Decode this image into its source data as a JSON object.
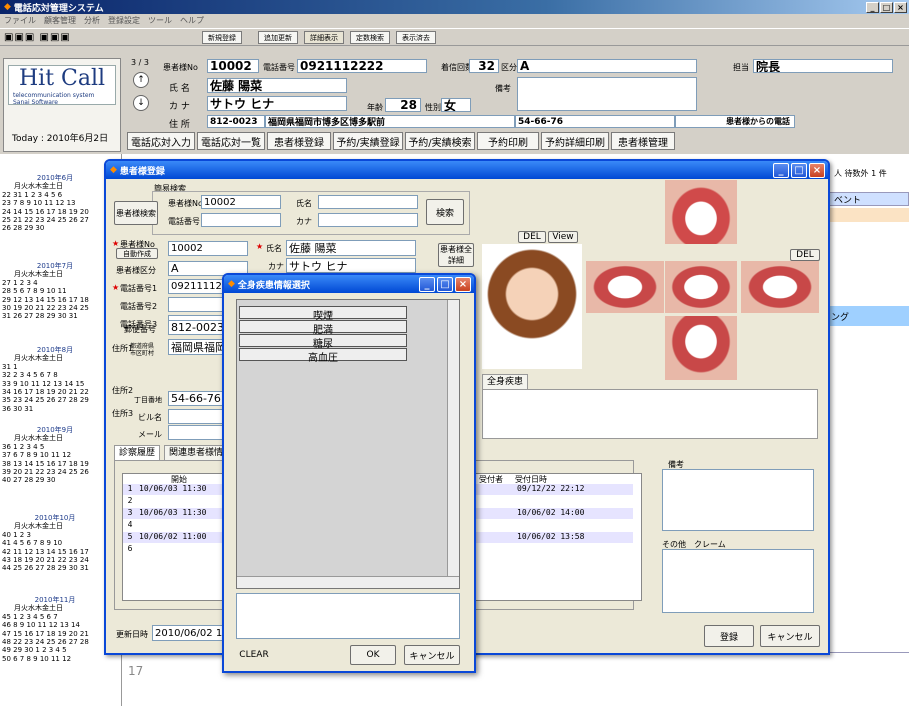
{
  "main": {
    "title": "電話応対管理システム",
    "menu": [
      "ファイル",
      "顧客管理",
      "分析",
      "登録設定",
      "ツール",
      "ヘルプ"
    ]
  },
  "toolbar": {
    "new": "新規登録",
    "add": "追加更新",
    "detail": "詳細表示",
    "reload": "定数検索",
    "display": "表示済去"
  },
  "logo": {
    "title": "Hit Call",
    "sub1": "telecommunication system",
    "sub2": "Sanai Software",
    "today": "Today : 2010年6月2日"
  },
  "patient": {
    "page": "3 / 3",
    "no_label": "患者様No",
    "no": "10002",
    "tel_label": "電話番号",
    "tel": "0921112222",
    "visits_label": "着信回数",
    "visits": "32",
    "kubun_label": "区分",
    "kubun": "A",
    "tanto_label": "担当",
    "tanto": "院長",
    "name_label": "氏 名",
    "name": "佐藤 陽菜",
    "biko_label": "備考",
    "kana_label": "カ ナ",
    "kana": "サトウ ヒナ",
    "age_label": "年齢",
    "age": "28",
    "sex_label": "性別",
    "sex": "女",
    "addr_label": "住 所",
    "zip": "812-0023",
    "addr": "福岡県福岡市博多区博多駅前",
    "chome": "54-66-76",
    "from": "患者様からの電話"
  },
  "nav": [
    "電話応対入力",
    "電話応対一覧",
    "患者様登録",
    "予約/実績登録",
    "予約/実績検索",
    "予約印刷",
    "予約詳細印刷",
    "患者様管理"
  ],
  "calendar": [
    {
      "title": "2010年6月",
      "dow": "月火水木金土日",
      "rows": [
        "22 31 1 2 3 4 5 6",
        "23 7 8 9 10 11 12 13",
        "24 14 15 16 17 18 19 20",
        "25 21 22 23 24 25 26 27",
        "26 28 29 30"
      ]
    },
    {
      "title": "2010年7月",
      "dow": "月火水木金土日",
      "rows": [
        "27  1 2 3 4",
        "28 5 6 7 8 9 10 11",
        "29 12 13 14 15 16 17 18",
        "30 19 20 21 22 23 24 25",
        "31 26 27 28 29 30 31"
      ]
    },
    {
      "title": "2010年8月",
      "dow": "月火水木金土日",
      "rows": [
        "31  1",
        "32 2 3 4 5 6 7 8",
        "33 9 10 11 12 13 14 15",
        "34 16 17 18 19 20 21 22",
        "35 23 24 25 26 27 28 29",
        "36 30 31"
      ]
    },
    {
      "title": "2010年9月",
      "dow": "月火水木金土日",
      "rows": [
        "36  1 2 3 4 5",
        "37 6 7 8 9 10 11 12",
        "38 13 14 15 16 17 18 19",
        "39 20 21 22 23 24 25 26",
        "40 27 28 29 30"
      ]
    },
    {
      "title": "2010年10月",
      "dow": "月火水木金土日",
      "rows": [
        "40  1 2 3",
        "41 4 5 6 7 8 9 10",
        "42 11 12 13 14 15 16 17",
        "43 18 19 20 21 22 23 24",
        "44 25 26 27 28 29 30 31"
      ]
    },
    {
      "title": "2010年11月",
      "dow": "月火水木金土日",
      "rows": [
        "45 1 2 3 4 5 6 7",
        "46 8 9 10 11 12 13 14",
        "47 15 16 17 18 19 20 21",
        "48 22 23 24 25 26 27 28",
        "49 29 30 1 2 3 4 5",
        "50 6 7 8 9 10 11 12"
      ]
    }
  ],
  "right": {
    "status": "人 待数外 1 件",
    "event": "ベント",
    "ng": "ング",
    "time": "17"
  },
  "reg": {
    "title": "患者様登録",
    "search_group": "簡易検索",
    "search_btn": "患者様検索",
    "s_no_label": "患者様No",
    "s_no": "10002",
    "s_tel_label": "電話番号",
    "s_name_label": "氏名",
    "s_kana_label": "カナ",
    "kensaku": "検索",
    "auto_label": "患者様No",
    "auto_btn": "自動作成",
    "no": "10002",
    "name_label": "氏名",
    "name": "佐藤 陽菜",
    "kana_label": "カナ",
    "kana": "サトウ ヒナ",
    "detail_btn": "患者様全詳細",
    "kubun_label": "患者様区分",
    "kubun": "A",
    "tel1_label": "電話番号1",
    "tel1": "0921111222",
    "tel2_label": "電話番号2",
    "tel3_label": "電話番号3",
    "zip_label": "郵便番号",
    "zip": "812-0023",
    "addr1_label": "住所1",
    "pref_label": "都道府県",
    "city_label": "市区町村",
    "addr": "福岡県福岡",
    "addr2_label": "住所2",
    "chome_label": "丁目番地",
    "chome": "54-66-76",
    "addr3_label": "住所3",
    "bldg_label": "ビル名",
    "mail_label": "メール",
    "del1": "DEL",
    "view": "View",
    "del2": "DEL",
    "disease_tab": "全身疾患",
    "tab1": "診察履歴",
    "tab2": "関連患者様情報",
    "hist_cols": [
      "開始",
      "受付者",
      "受付日時"
    ],
    "hist": [
      {
        "n": "1",
        "start": "10/06/03 11:30",
        "date": "09/12/22 22:12"
      },
      {
        "n": "2",
        "start": "",
        "date": ""
      },
      {
        "n": "3",
        "start": "10/06/03 11:30",
        "date": "10/06/02 14:00"
      },
      {
        "n": "4",
        "start": "",
        "date": ""
      },
      {
        "n": "5",
        "start": "10/06/02 11:00",
        "date": "10/06/02 13:58"
      },
      {
        "n": "6",
        "start": "",
        "date": ""
      }
    ],
    "biko_label": "備考",
    "other_label": "その他",
    "claim_label": "クレーム",
    "updated_label": "更新日時",
    "updated": "2010/06/02 1",
    "save": "登録",
    "cancel": "キャンセル"
  },
  "dlg": {
    "title": "全身疾患情報選択",
    "items": [
      "喫煙",
      "肥満",
      "糖尿",
      "高血圧"
    ],
    "clear": "CLEAR",
    "ok": "OK",
    "cancel": "キャンセル"
  }
}
